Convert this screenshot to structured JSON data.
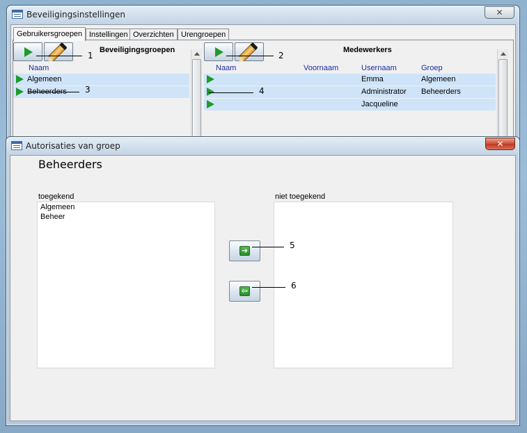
{
  "window_main": {
    "title": "Beveiligingsinstellingen",
    "close_symbol": "✕",
    "tabs": [
      {
        "label": "Gebruikersgroepen"
      },
      {
        "label": "Instellingen"
      },
      {
        "label": "Overzichten"
      },
      {
        "label": "Urengroepen"
      }
    ],
    "groups_panel": {
      "title": "Beveiligingsgroepen",
      "column_name": "Naam",
      "rows": [
        {
          "name": "Algemeen"
        },
        {
          "name": "Beheerders"
        }
      ]
    },
    "employees_panel": {
      "title": "Medewerkers",
      "columns": {
        "name": "Naam",
        "first_name": "Voornaam",
        "username": "Usernaam",
        "group": "Groep"
      },
      "rows": [
        {
          "name": "",
          "first_name": "",
          "username": "Emma",
          "group": "Algemeen"
        },
        {
          "name": "",
          "first_name": "",
          "username": "Administrator",
          "group": "Beheerders"
        },
        {
          "name": "",
          "first_name": "",
          "username": "Jacqueline",
          "group": ""
        }
      ]
    }
  },
  "window_auth": {
    "title": "Autorisaties van groep",
    "close_symbol": "✕",
    "group_name": "Beheerders",
    "granted_label": "toegekend",
    "granted_items": [
      "Algemeen",
      "Beheer"
    ],
    "not_granted_label": "niet toegekend",
    "not_granted_items": [],
    "move_right_symbol": "➔",
    "move_left_symbol": "⇦"
  },
  "callouts": [
    "1",
    "2",
    "3",
    "4",
    "5",
    "6"
  ],
  "colors": {
    "accent_green": "#1f9a2a",
    "row_highlight": "#cfe4f8",
    "header_text": "#1a2b9c",
    "close_red": "#c03b24"
  },
  "icons": {
    "open": "play-icon",
    "edit": "pencil-icon",
    "row_selector": "arrow-right-icon",
    "move_right": "arrow-right-box-icon",
    "move_left": "arrow-left-box-icon"
  }
}
